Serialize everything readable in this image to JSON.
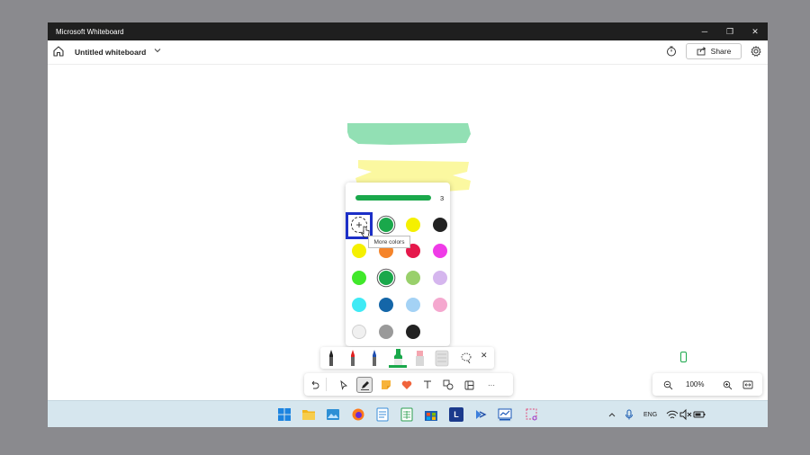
{
  "window": {
    "title": "Microsoft Whiteboard",
    "minimize_label": "─",
    "restore_label": "❐",
    "close_label": "✕"
  },
  "appbar": {
    "board_title": "Untitled whiteboard",
    "share_label": "Share"
  },
  "canvas": {
    "strokes": [
      {
        "color": "#92e0b4"
      },
      {
        "color": "#fbf8a0"
      }
    ]
  },
  "pen_panel": {
    "thickness_value": "3",
    "thickness_fraction": 0.4,
    "recent_colors": [
      "#1aa84b",
      "#f5f000",
      "#222222"
    ],
    "palette": [
      [
        "#f5f000",
        "#f5842a",
        "#e5184b",
        "#ef3be7"
      ],
      [
        "#40e82a",
        "#1aa84b",
        "#99d06b",
        "#d5b6ee"
      ],
      [
        "#3feaf5",
        "#1466a8",
        "#a4d2f5",
        "#f5a8cf"
      ],
      [
        "#f0f0f0",
        "#9a9a9a",
        "#222222"
      ]
    ],
    "selected_color": "#1aa84b",
    "more_colors_label": "+",
    "tooltip": "More colors"
  },
  "pen_tray": {
    "close_label": "✕"
  },
  "toolbar": {
    "more_label": "···"
  },
  "zoom": {
    "level": "100%"
  },
  "taskbar": {
    "language": "ENG",
    "word_label": "L"
  },
  "accent": "#1c2fc7"
}
